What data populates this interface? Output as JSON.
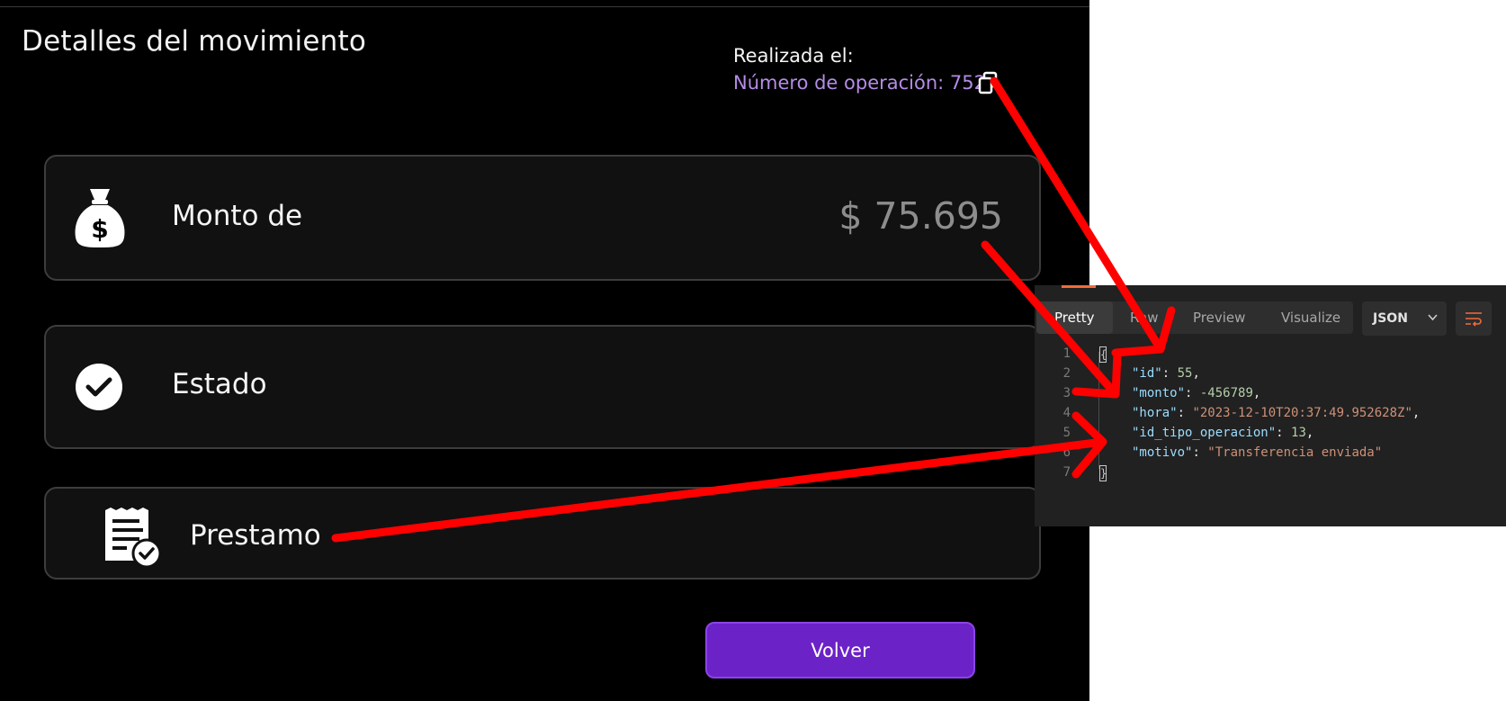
{
  "header": {
    "title": "Detalles del movimiento",
    "realizada_label": "Realizada el:",
    "operation_number": "Número de operación: 752"
  },
  "cards": {
    "monto": {
      "label": "Monto de",
      "value": "$ 75.695",
      "icon": "money-bag-icon"
    },
    "estado": {
      "label": "Estado",
      "icon": "check-circle-icon"
    },
    "tipo": {
      "label": "Prestamo",
      "icon": "receipt-check-icon"
    }
  },
  "actions": {
    "back_label": "Volver"
  },
  "response_panel": {
    "tabs": [
      "Pretty",
      "Raw",
      "Preview",
      "Visualize"
    ],
    "active_tab": "Pretty",
    "format": "JSON",
    "line_numbers": [
      "1",
      "2",
      "3",
      "4",
      "5",
      "6",
      "7"
    ],
    "lines": [
      {
        "key": "\"id\"",
        "value": "55",
        "type": "number"
      },
      {
        "key": "\"monto\"",
        "value": "-456789",
        "type": "number"
      },
      {
        "key": "\"hora\"",
        "value": "\"2023-12-10T20:37:49.952628Z\"",
        "type": "string"
      },
      {
        "key": "\"id_tipo_operacion\"",
        "value": "13",
        "type": "number"
      },
      {
        "key": "\"motivo\"",
        "value": "\"Transferencia enviada\"",
        "type": "string"
      }
    ]
  },
  "colors": {
    "accent_purple": "#6b22c6",
    "link_purple": "#b48ce6",
    "annotation_red": "#ff0000",
    "postman_orange": "#f26b3a"
  }
}
